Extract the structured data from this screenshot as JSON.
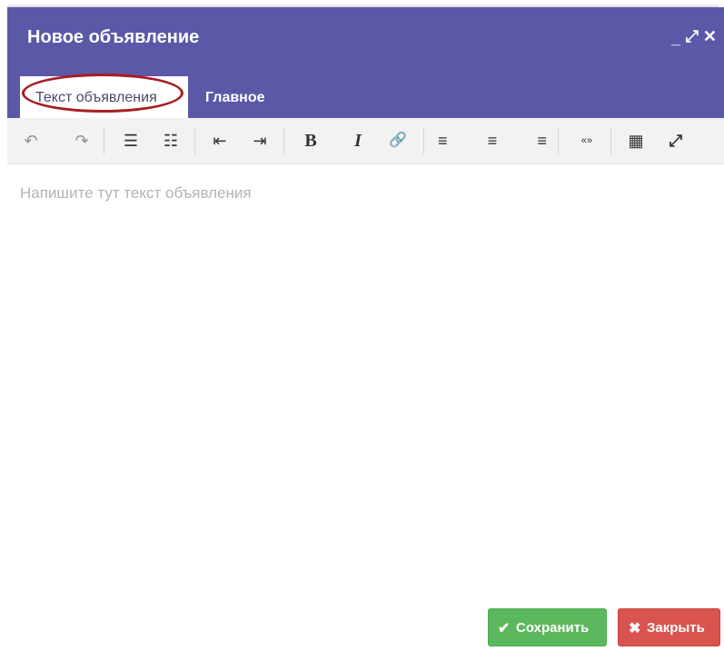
{
  "window": {
    "title": "Новое объявление",
    "controls": {
      "minimize": "_",
      "maximize": "⤢",
      "close": "✕"
    }
  },
  "tabs": [
    {
      "label": "Текст объявления",
      "active": true
    },
    {
      "label": "Главное",
      "active": false
    }
  ],
  "toolbar": {
    "icons": [
      "undo-icon",
      "redo-icon",
      "bullet-list-icon",
      "numbered-list-icon",
      "outdent-icon",
      "indent-icon",
      "bold-icon",
      "italic-icon",
      "link-icon",
      "align-left-icon",
      "align-center-icon",
      "align-right-icon",
      "blockquote-icon",
      "media-icon",
      "fullscreen-icon"
    ],
    "glyphs": {
      "undo": "↶",
      "redo": "↷",
      "bullet_list": "☰",
      "numbered_list": "☷",
      "outdent": "⇤",
      "indent": "⇥",
      "bold": "B",
      "italic": "I",
      "link": "🔗",
      "align_left": "≡",
      "align_center": "≡",
      "align_right": "≡",
      "quote": "«»",
      "media": "▦",
      "fullscreen": "⤢"
    }
  },
  "editor": {
    "placeholder": "Напишите тут текст объявления"
  },
  "buttons": {
    "save": {
      "icon": "✔",
      "label": "Сохранить"
    },
    "close": {
      "icon": "✖",
      "label": "Закрыть"
    }
  },
  "colors": {
    "header": "#5b58a8",
    "save": "#5cb85c",
    "close": "#d9534f",
    "annotation_circle": "#a81c22"
  }
}
